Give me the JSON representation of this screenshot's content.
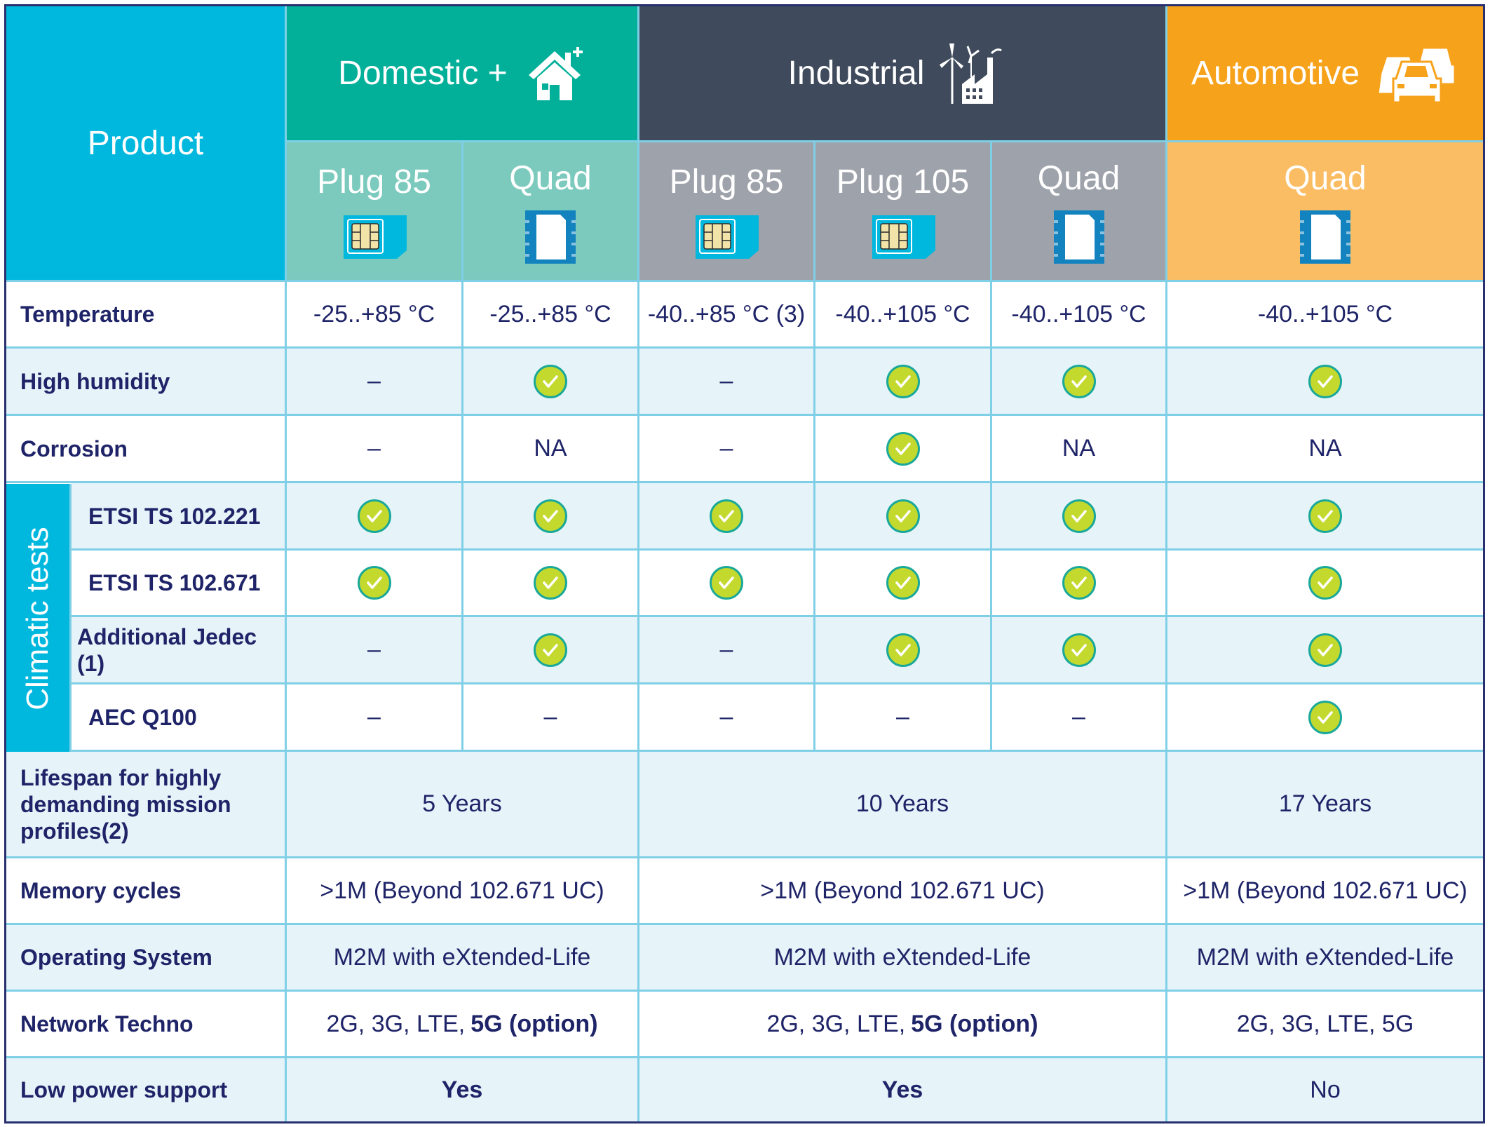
{
  "header": {
    "product_label": "Product",
    "groups": [
      {
        "label": "Domestic +",
        "icon": "house-plus-icon",
        "color": "#02b09a"
      },
      {
        "label": "Industrial",
        "icon": "factory-windturbine-icon",
        "color": "#3f4a5c"
      },
      {
        "label": "Automotive",
        "icon": "cars-icon",
        "color": "#f7a21b"
      }
    ],
    "products": [
      {
        "label": "Plug 85",
        "icon": "sim-card-icon",
        "group": "Domestic +",
        "color": "#7bcabd"
      },
      {
        "label": "Quad",
        "icon": "quad-chip-icon",
        "group": "Domestic +",
        "color": "#7bcabd"
      },
      {
        "label": "Plug 85",
        "icon": "sim-card-icon",
        "group": "Industrial",
        "color": "#9ea2ab"
      },
      {
        "label": "Plug 105",
        "icon": "sim-card-icon",
        "group": "Industrial",
        "color": "#9ea2ab"
      },
      {
        "label": "Quad",
        "icon": "quad-chip-icon",
        "group": "Industrial",
        "color": "#9ea2ab"
      },
      {
        "label": "Quad",
        "icon": "quad-chip-icon",
        "group": "Automotive",
        "color": "#fbbd63"
      }
    ]
  },
  "climatic_group_label": "Climatic tests",
  "rows": [
    {
      "label": "Temperature",
      "values": [
        "-25..+85 °C",
        "-25..+85 °C",
        "-40..+85 °C (3)",
        "-40..+105 °C",
        "-40..+105 °C",
        "-40..+105 °C"
      ]
    },
    {
      "label": "High humidity",
      "values": [
        "–",
        "check",
        "–",
        "check",
        "check",
        "check"
      ]
    },
    {
      "label": "Corrosion",
      "values": [
        "–",
        "NA",
        "–",
        "check",
        "NA",
        "NA"
      ]
    },
    {
      "label": "ETSI TS 102.221",
      "values": [
        "check",
        "check",
        "check",
        "check",
        "check",
        "check"
      ]
    },
    {
      "label": "ETSI TS 102.671",
      "values": [
        "check",
        "check",
        "check",
        "check",
        "check",
        "check"
      ]
    },
    {
      "label": "Additional Jedec (1)",
      "values": [
        "–",
        "check",
        "–",
        "check",
        "check",
        "check"
      ]
    },
    {
      "label": "AEC Q100",
      "values": [
        "–",
        "–",
        "–",
        "–",
        "–",
        "check"
      ]
    }
  ],
  "merged_rows": [
    {
      "label": "Lifespan for highly demanding mission profiles(2)",
      "values": [
        "5 Years",
        "10 Years",
        "17 Years"
      ]
    },
    {
      "label": "Memory cycles",
      "values": [
        ">1M (Beyond 102.671 UC)",
        ">1M (Beyond 102.671 UC)",
        ">1M (Beyond 102.671 UC)"
      ]
    },
    {
      "label": "Operating System",
      "values": [
        "M2M with eXtended-Life",
        "M2M with eXtended-Life",
        "M2M with eXtended-Life"
      ]
    },
    {
      "label": "Network Techno",
      "values": [
        {
          "plain": "2G, 3G, LTE, ",
          "bold": "5G (option)"
        },
        {
          "plain": "2G, 3G, LTE, ",
          "bold": "5G (option)"
        },
        {
          "plain": "2G, 3G, LTE, 5G",
          "bold": ""
        }
      ]
    },
    {
      "label": "Low power support",
      "values": [
        "Yes",
        "Yes",
        "No"
      ],
      "bold": [
        true,
        true,
        false
      ]
    }
  ]
}
